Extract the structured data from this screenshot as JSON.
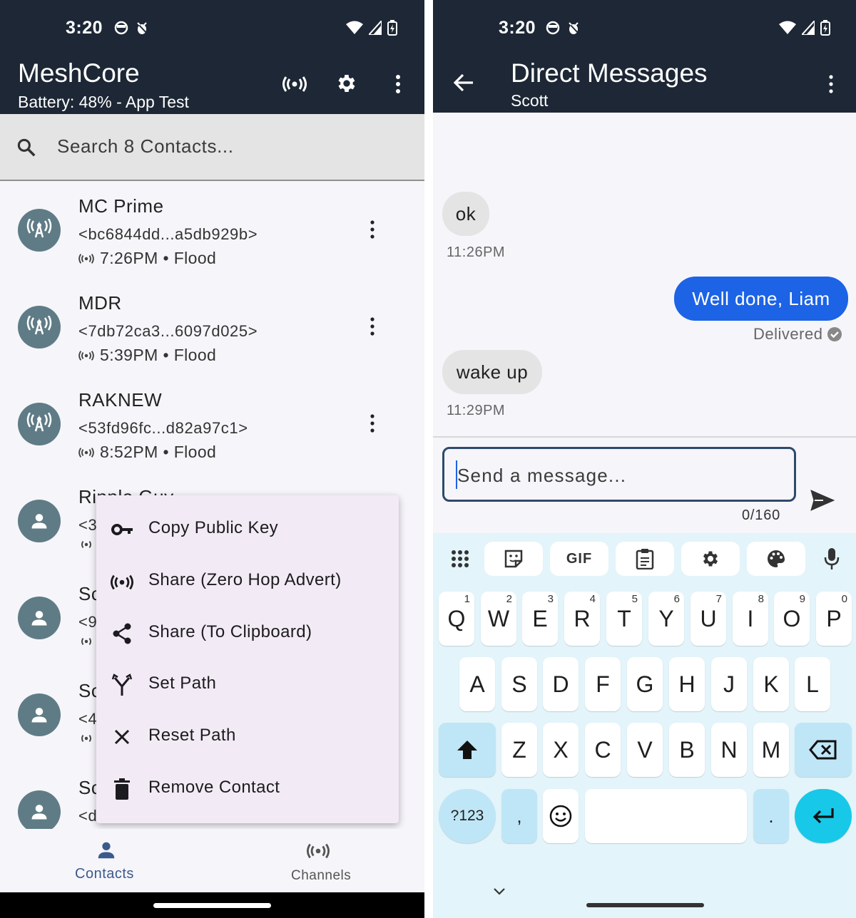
{
  "left": {
    "status": {
      "time": "3:20"
    },
    "header": {
      "title": "MeshCore",
      "subtitle": "Battery: 48% - App Test"
    },
    "search": {
      "placeholder": "Search 8 Contacts..."
    },
    "contacts": [
      {
        "name": "MC Prime",
        "key": "<bc6844dd...a5db929b>",
        "meta": "7:26PM • Flood",
        "type": "repeater"
      },
      {
        "name": "MDR",
        "key": "<7db72ca3...6097d025>",
        "meta": "5:39PM • Flood",
        "type": "repeater"
      },
      {
        "name": "RAKNEW",
        "key": "<53fd96fc...d82a97c1>",
        "meta": "8:52PM • Flood",
        "type": "repeater"
      },
      {
        "name": "Ripple Guy",
        "key": "<3",
        "type": "person"
      },
      {
        "name": "Sc",
        "key": "<9",
        "type": "person"
      },
      {
        "name": "Sc",
        "key": "<4",
        "type": "person"
      },
      {
        "name": "Sc",
        "key": "<d",
        "type": "person"
      }
    ],
    "context_menu": [
      {
        "label": "Copy Public Key",
        "icon": "key-icon"
      },
      {
        "label": "Share (Zero Hop Advert)",
        "icon": "broadcast-icon"
      },
      {
        "label": "Share (To Clipboard)",
        "icon": "share-icon"
      },
      {
        "label": "Set Path",
        "icon": "path-icon"
      },
      {
        "label": "Reset Path",
        "icon": "close-icon"
      },
      {
        "label": "Remove Contact",
        "icon": "trash-icon"
      }
    ],
    "bottom_nav": {
      "contacts": "Contacts",
      "channels": "Channels"
    },
    "colors": {
      "appbar": "#1d2735",
      "accent": "#3b5a8c",
      "avatar": "#5f7c86"
    }
  },
  "right": {
    "status": {
      "time": "3:20"
    },
    "header": {
      "title": "Direct Messages",
      "subtitle": "Scott"
    },
    "messages": [
      {
        "text": "ok",
        "time": "11:26PM",
        "direction": "in"
      },
      {
        "text": "Well done, Liam",
        "status": "Delivered",
        "direction": "out"
      },
      {
        "text": "wake up",
        "time": "11:29PM",
        "direction": "in"
      }
    ],
    "composer": {
      "placeholder": "Send a message...",
      "counter": "0/160"
    },
    "keyboard": {
      "toolbar": [
        "apps-icon",
        "sticker-icon",
        "GIF",
        "clipboard-icon",
        "gear-icon",
        "palette-icon",
        "mic-icon"
      ],
      "row1": [
        "Q",
        "W",
        "E",
        "R",
        "T",
        "Y",
        "U",
        "I",
        "O",
        "P"
      ],
      "row1_hints": [
        "1",
        "2",
        "3",
        "4",
        "5",
        "6",
        "7",
        "8",
        "9",
        "0"
      ],
      "row2": [
        "A",
        "S",
        "D",
        "F",
        "G",
        "H",
        "J",
        "K",
        "L"
      ],
      "row3": [
        "Z",
        "X",
        "C",
        "V",
        "B",
        "N",
        "M"
      ],
      "symbols": "?123",
      "comma": ",",
      "period": "."
    },
    "colors": {
      "bubble_out": "#1c63e6",
      "bubble_in": "#e4e4e4",
      "enter_key": "#18c8e8"
    }
  }
}
